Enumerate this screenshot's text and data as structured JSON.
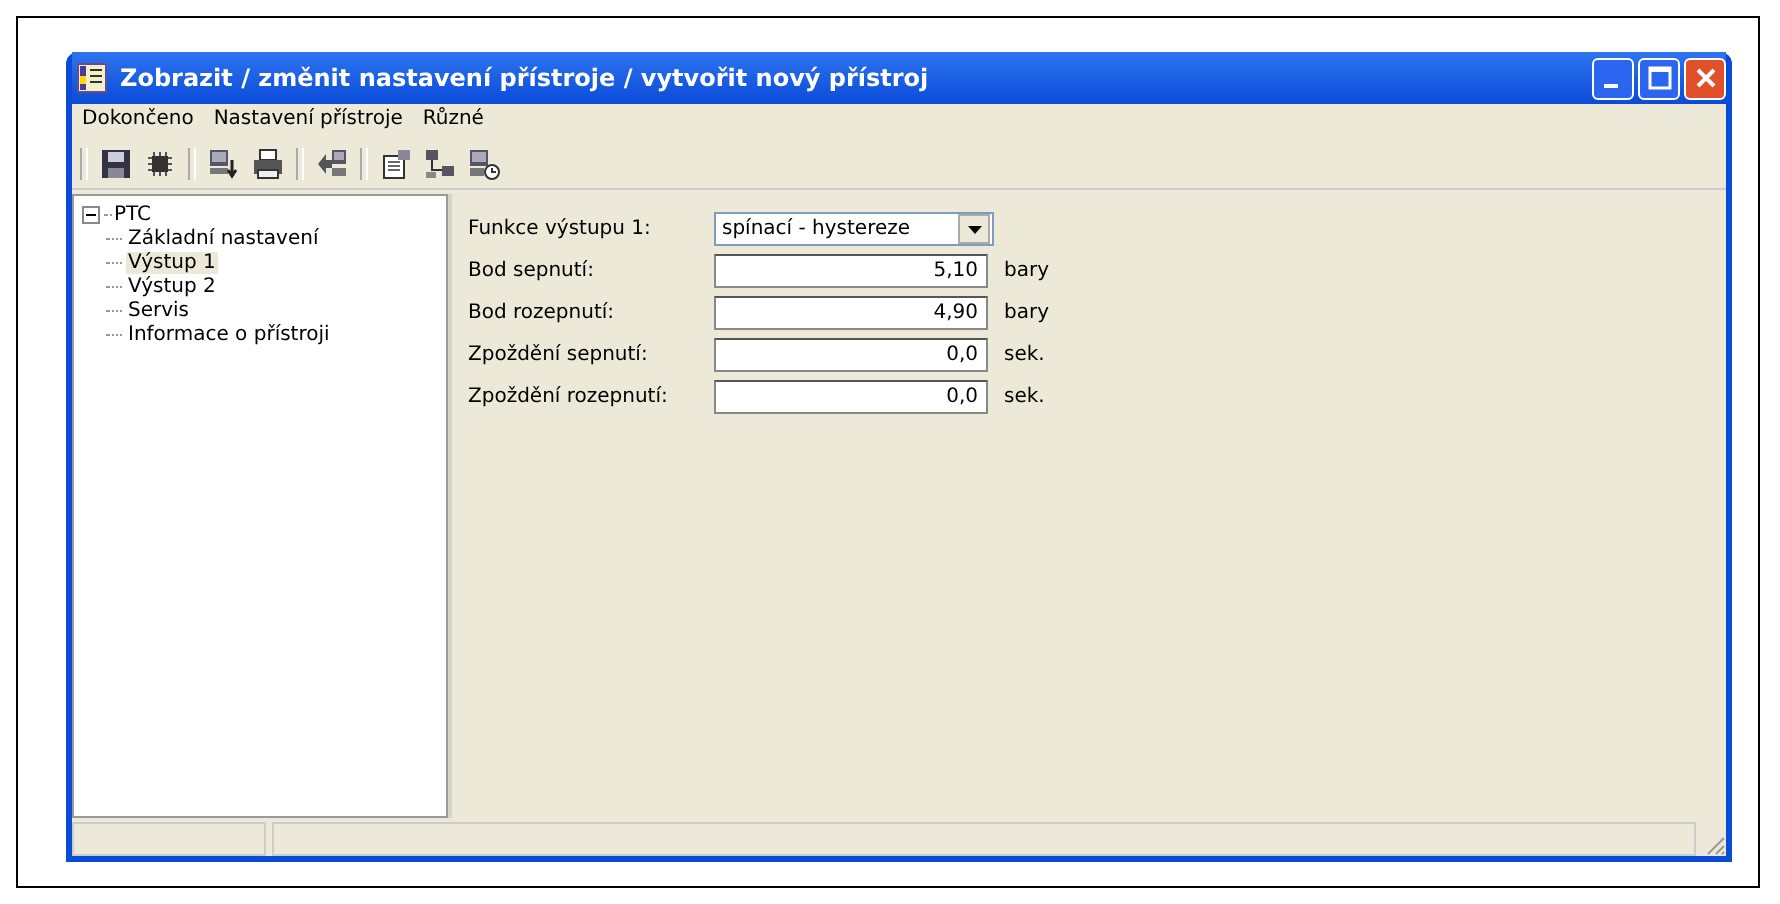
{
  "window": {
    "title": "Zobrazit / změnit nastavení přístroje / vytvořit nový přístroj"
  },
  "menu": [
    "Dokončeno",
    "Nastavení přístroje",
    "Různé"
  ],
  "toolbar": [
    {
      "kind": "sep"
    },
    {
      "kind": "save"
    },
    {
      "kind": "chip"
    },
    {
      "kind": "sep"
    },
    {
      "kind": "down"
    },
    {
      "kind": "print"
    },
    {
      "kind": "sep"
    },
    {
      "kind": "transfer"
    },
    {
      "kind": "sep"
    },
    {
      "kind": "props"
    },
    {
      "kind": "network"
    },
    {
      "kind": "clock"
    }
  ],
  "tree": [
    {
      "label": "PTC",
      "expanded": true,
      "selected": false,
      "children": [
        {
          "label": "Základní nastavení",
          "selected": false
        },
        {
          "label": "Výstup 1",
          "selected": true
        },
        {
          "label": "Výstup 2",
          "selected": false
        },
        {
          "label": "Servis",
          "selected": false
        },
        {
          "label": "Informace o přístroji",
          "selected": false
        }
      ]
    }
  ],
  "form": [
    {
      "kind": "dropdown",
      "label": "Funkce výstupu 1:",
      "value": "spínací - hystereze"
    },
    {
      "kind": "number",
      "label": "Bod sepnutí:",
      "value": "5,10",
      "unit": "bary"
    },
    {
      "kind": "number",
      "label": "Bod rozepnutí:",
      "value": "4,90",
      "unit": "bary"
    },
    {
      "kind": "number",
      "label": "Zpoždění sepnutí:",
      "value": "0,0",
      "unit": "sek."
    },
    {
      "kind": "number",
      "label": "Zpoždění rozepnutí:",
      "value": "0,0",
      "unit": "sek."
    }
  ]
}
